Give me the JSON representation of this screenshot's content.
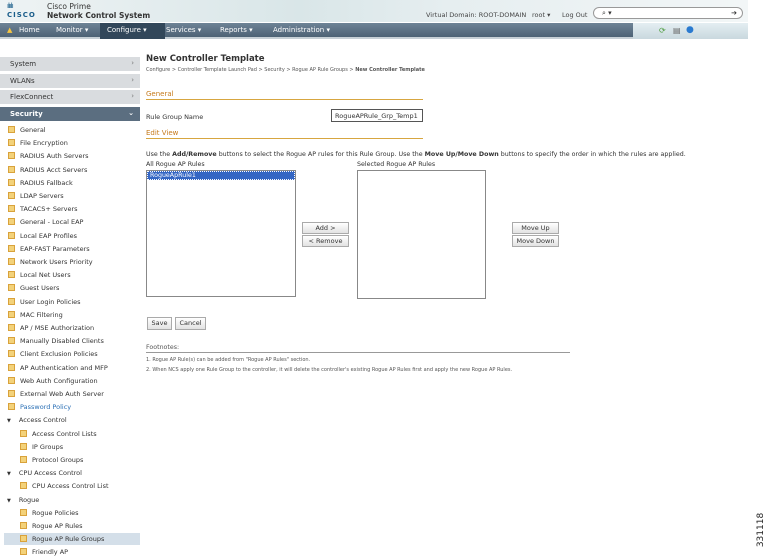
{
  "header": {
    "logo_bars": "ılıılı",
    "logo": "CISCO",
    "product_line1": "Cisco Prime",
    "product_line2": "Network Control System",
    "virtual_domain": "Virtual Domain: ROOT-DOMAIN",
    "user": "root ▾",
    "logout": "Log Out",
    "search_icon": "⌕ ▾",
    "search_go": "➔"
  },
  "nav": {
    "home": "Home",
    "monitor": "Monitor ▾",
    "configure": "Configure ▾",
    "services": "Services ▾",
    "reports": "Reports ▾",
    "administration": "Administration ▾"
  },
  "sidebar": {
    "accordion": [
      {
        "label": "System"
      },
      {
        "label": "WLANs"
      },
      {
        "label": "FlexConnect"
      },
      {
        "label": "Security"
      }
    ],
    "items": [
      "General",
      "File Encryption",
      "RADIUS Auth Servers",
      "RADIUS Acct Servers",
      "RADIUS Fallback",
      "LDAP Servers",
      "TACACS+ Servers",
      "General - Local EAP",
      "Local EAP Profiles",
      "EAP-FAST Parameters",
      "Network Users Priority",
      "Local Net Users",
      "Guest Users",
      "User Login Policies",
      "MAC Filtering",
      "AP / MSE Authorization",
      "Manually Disabled Clients",
      "Client Exclusion Policies",
      "AP Authentication and MFP",
      "Web Auth Configuration",
      "External Web Auth Server",
      "Password Policy"
    ],
    "groups": [
      {
        "label": "Access Control",
        "items": [
          "Access Control Lists",
          "IP Groups",
          "Protocol Groups"
        ]
      },
      {
        "label": "CPU Access Control",
        "items": [
          "CPU Access Control List"
        ]
      },
      {
        "label": "Rogue",
        "items": [
          "Rogue Policies",
          "Rogue AP Rules",
          "Rogue AP Rule Groups",
          "Friendly AP"
        ]
      }
    ]
  },
  "main": {
    "title": "New Controller Template",
    "breadcrumb": "Configure > Controller Template Launch Pad > Security > Rogue AP Rule Groups > ",
    "breadcrumb_current": "New Controller Template",
    "general": "General",
    "rule_group_label": "Rule Group Name",
    "rule_group_value": "RogueAPRule_Grp_Temp1",
    "edit_view": "Edit View",
    "instr1": "Use the ",
    "instr_b1": "Add/Remove",
    "instr2": " buttons to select the Rogue AP rules for this Rule Group. Use the ",
    "instr_b2": "Move Up/Move Down",
    "instr3": " buttons to specify the order in which the rules are applied.",
    "all_rules_label": "All Rogue AP Rules",
    "all_rules": [
      "RogueApRule1"
    ],
    "selected_label": "Selected Rogue AP Rules",
    "add": "Add >",
    "remove": "< Remove",
    "move_up": "Move Up",
    "move_down": "Move Down",
    "save": "Save",
    "cancel": "Cancel",
    "footnotes_title": "Footnotes:",
    "footnote1": "1. Rogue AP Rule(s) can be added from \"Rogue AP Rules\" section.",
    "footnote2": "2. When NCS apply one Rule Group to the controller, it will delete the controller's existing Rogue AP Rules first and apply the new Rogue AP Rules."
  },
  "figure_id": "331118"
}
